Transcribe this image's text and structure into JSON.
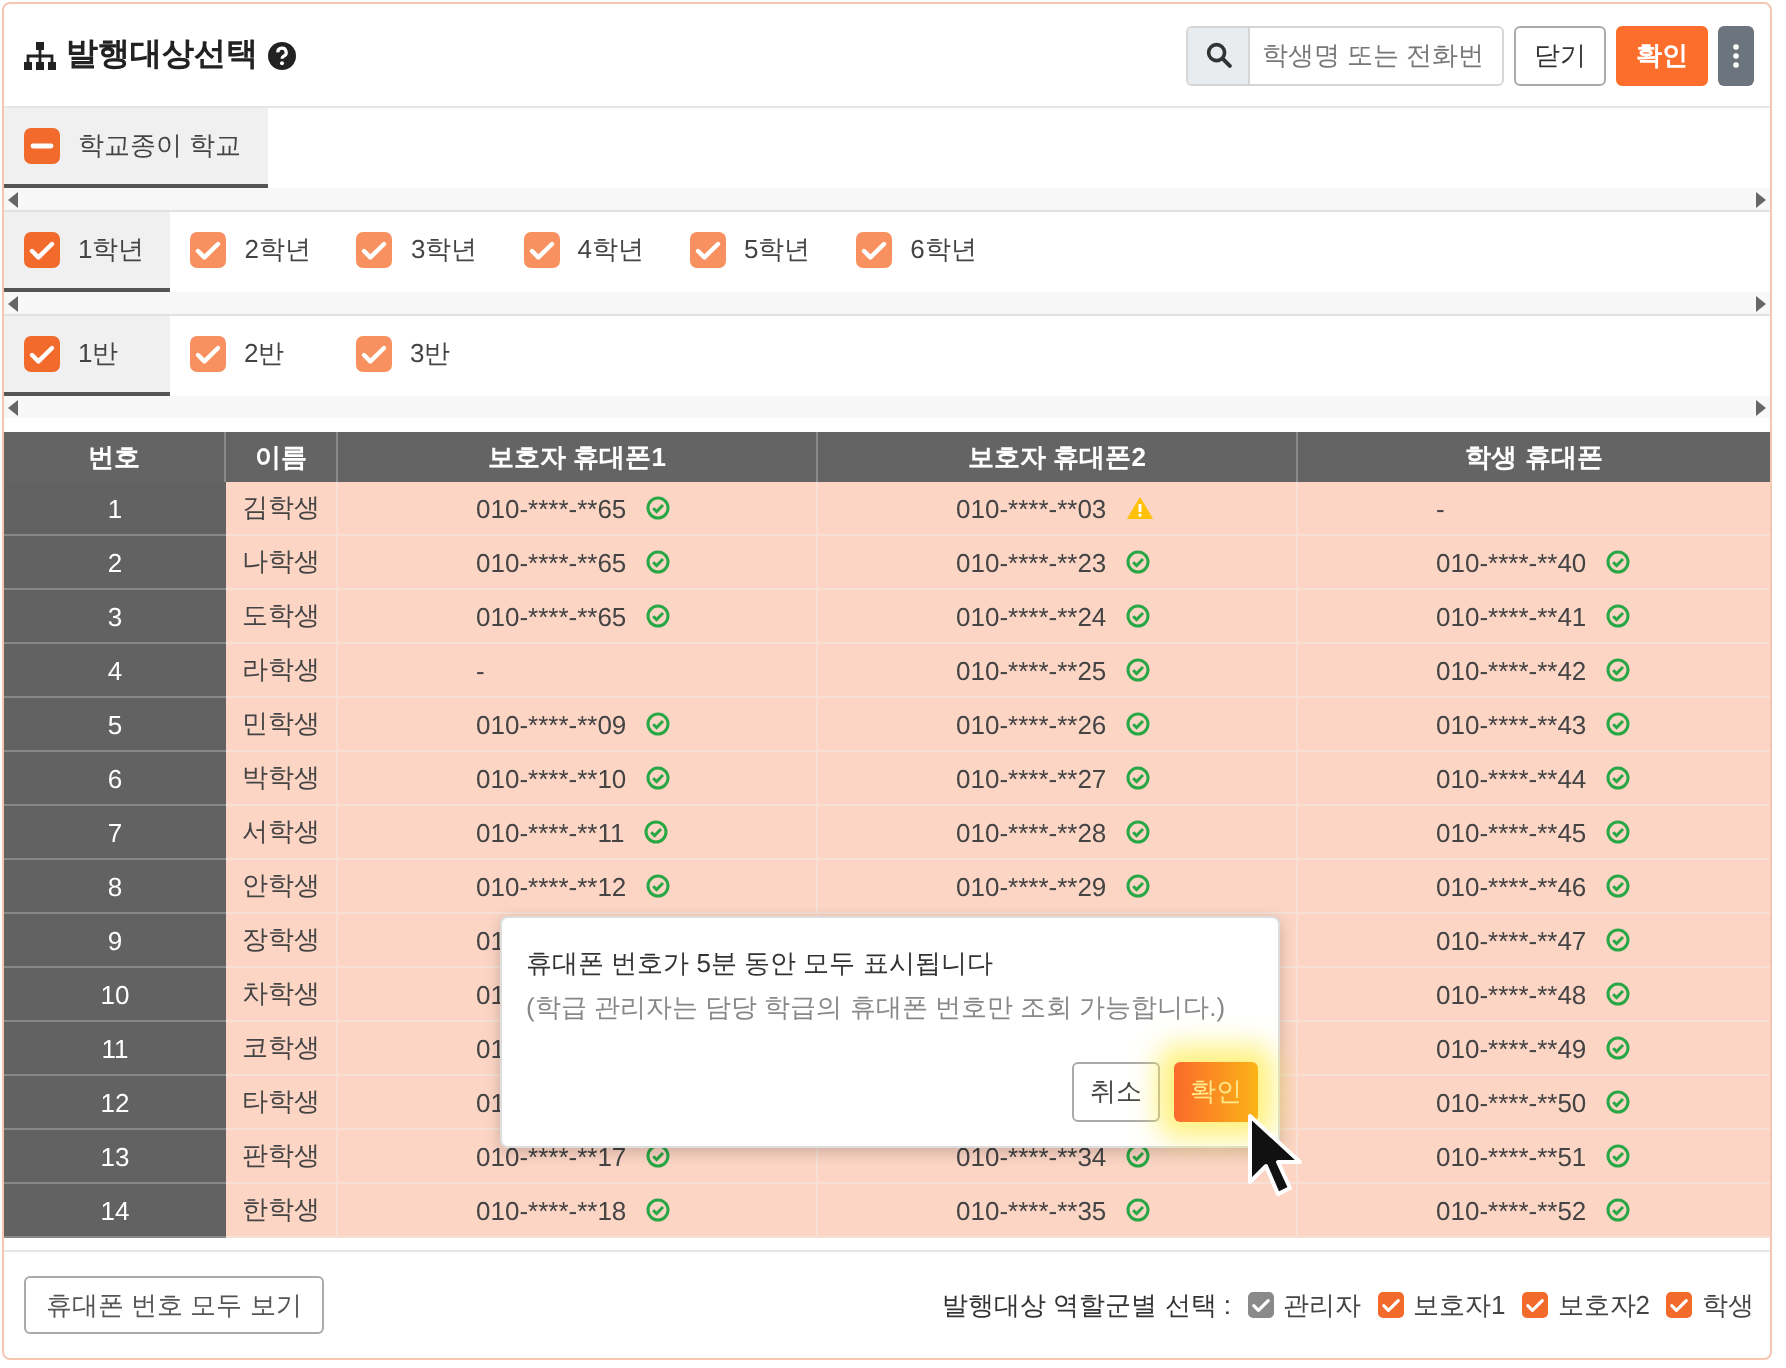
{
  "header": {
    "title": "발행대상선택",
    "search": {
      "placeholder": "학생명 또는 전화번"
    },
    "close_button": "닫기",
    "confirm_button": "확인"
  },
  "school_tabs": [
    {
      "label": "학교종이 학교",
      "checked": true,
      "indeterminate": true,
      "selected": true
    }
  ],
  "grade_tabs": [
    {
      "label": "1학년",
      "checked": true,
      "indeterminate": false,
      "selected": true
    },
    {
      "label": "2학년",
      "checked": true,
      "indeterminate": false,
      "selected": false
    },
    {
      "label": "3학년",
      "checked": true,
      "indeterminate": false,
      "selected": false
    },
    {
      "label": "4학년",
      "checked": true,
      "indeterminate": false,
      "selected": false
    },
    {
      "label": "5학년",
      "checked": true,
      "indeterminate": false,
      "selected": false
    },
    {
      "label": "6학년",
      "checked": true,
      "indeterminate": false,
      "selected": false
    }
  ],
  "class_tabs": [
    {
      "label": "1반",
      "checked": true,
      "indeterminate": false,
      "selected": true
    },
    {
      "label": "2반",
      "checked": true,
      "indeterminate": false,
      "selected": false
    },
    {
      "label": "3반",
      "checked": true,
      "indeterminate": false,
      "selected": false
    }
  ],
  "table": {
    "columns": [
      "번호",
      "이름",
      "보호자 휴대폰1",
      "보호자 휴대폰2",
      "학생 휴대폰"
    ],
    "rows": [
      {
        "number": "1",
        "name": "김학생",
        "guardian1": {
          "text": "010-****-**65",
          "verified": true
        },
        "guardian2": {
          "text": "010-****-**03",
          "warning": true
        },
        "student": {
          "text": "-"
        }
      },
      {
        "number": "2",
        "name": "나학생",
        "guardian1": {
          "text": "010-****-**65",
          "verified": true
        },
        "guardian2": {
          "text": "010-****-**23",
          "verified": true
        },
        "student": {
          "text": "010-****-**40",
          "verified": true
        }
      },
      {
        "number": "3",
        "name": "도학생",
        "guardian1": {
          "text": "010-****-**65",
          "verified": true
        },
        "guardian2": {
          "text": "010-****-**24",
          "verified": true
        },
        "student": {
          "text": "010-****-**41",
          "verified": true
        }
      },
      {
        "number": "4",
        "name": "라학생",
        "guardian1": {
          "text": "-"
        },
        "guardian2": {
          "text": "010-****-**25",
          "verified": true
        },
        "student": {
          "text": "010-****-**42",
          "verified": true
        }
      },
      {
        "number": "5",
        "name": "민학생",
        "guardian1": {
          "text": "010-****-**09",
          "verified": true
        },
        "guardian2": {
          "text": "010-****-**26",
          "verified": true
        },
        "student": {
          "text": "010-****-**43",
          "verified": true
        }
      },
      {
        "number": "6",
        "name": "박학생",
        "guardian1": {
          "text": "010-****-**10",
          "verified": true
        },
        "guardian2": {
          "text": "010-****-**27",
          "verified": true
        },
        "student": {
          "text": "010-****-**44",
          "verified": true
        }
      },
      {
        "number": "7",
        "name": "서학생",
        "guardian1": {
          "text": "010-****-**11",
          "verified": true
        },
        "guardian2": {
          "text": "010-****-**28",
          "verified": true
        },
        "student": {
          "text": "010-****-**45",
          "verified": true
        }
      },
      {
        "number": "8",
        "name": "안학생",
        "guardian1": {
          "text": "010-****-**12",
          "verified": true
        },
        "guardian2": {
          "text": "010-****-**29",
          "verified": true
        },
        "student": {
          "text": "010-****-**46",
          "verified": true
        }
      },
      {
        "number": "9",
        "name": "장학생",
        "guardian1": {
          "text": "01"
        },
        "student": {
          "text": "010-****-**47",
          "verified": true
        }
      },
      {
        "number": "10",
        "name": "차학생",
        "guardian1": {
          "text": "01"
        },
        "student": {
          "text": "010-****-**48",
          "verified": true
        }
      },
      {
        "number": "11",
        "name": "코학생",
        "guardian1": {
          "text": "01"
        },
        "student": {
          "text": "010-****-**49",
          "verified": true
        }
      },
      {
        "number": "12",
        "name": "타학생",
        "guardian1": {
          "text": "01"
        },
        "student": {
          "text": "010-****-**50",
          "verified": true
        }
      },
      {
        "number": "13",
        "name": "판학생",
        "guardian1": {
          "text": "010-****-**17",
          "verified": true
        },
        "guardian2": {
          "text": "010-****-**34",
          "verified": true
        },
        "student": {
          "text": "010-****-**51",
          "verified": true
        }
      },
      {
        "number": "14",
        "name": "한학생",
        "guardian1": {
          "text": "010-****-**18",
          "verified": true
        },
        "guardian2": {
          "text": "010-****-**35",
          "verified": true
        },
        "student": {
          "text": "010-****-**52",
          "verified": true
        }
      }
    ]
  },
  "dialog": {
    "message": "휴대폰 번호가 5분 동안 모두 표시됩니다",
    "note": "(학급 관리자는 담당 학급의 휴대폰 번호만 조회 가능합니다.)",
    "cancel_button": "취소",
    "confirm_button": "확인"
  },
  "footer": {
    "show_all_button": "휴대폰 번호 모두 보기",
    "role_label": "발행대상 역할군별 선택 :",
    "roles": [
      {
        "label": "관리자",
        "checked": true,
        "disabled": true
      },
      {
        "label": "보호자1",
        "checked": true,
        "disabled": false
      },
      {
        "label": "보호자2",
        "checked": true,
        "disabled": false
      },
      {
        "label": "학생",
        "checked": true,
        "disabled": false
      }
    ]
  }
}
